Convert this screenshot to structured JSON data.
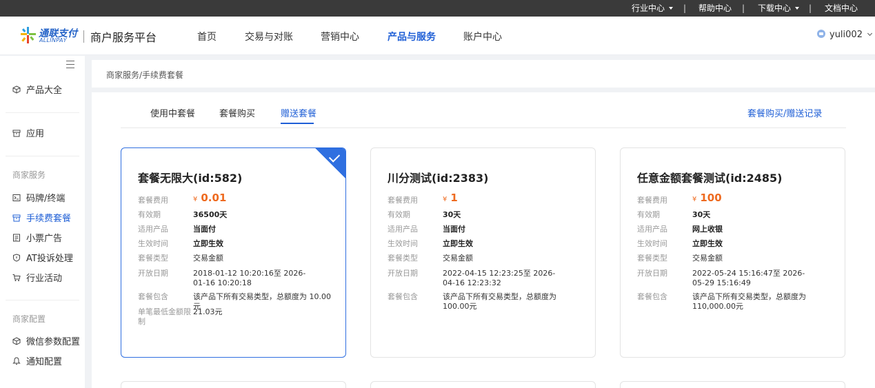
{
  "topbar": {
    "items": [
      "行业中心",
      "帮助中心",
      "下载中心",
      "文档中心"
    ],
    "separator": "|"
  },
  "header": {
    "logo_cn": "通联支付",
    "logo_en": "ALLINPAY",
    "platform_title": "商户服务平台",
    "nav": [
      "首页",
      "交易与对账",
      "营销中心",
      "产品与服务",
      "账户中心"
    ],
    "active_nav": "产品与服务",
    "username": "yuli002"
  },
  "sidebar": {
    "items_top": [
      "产品大全",
      "应用"
    ],
    "section_merchant_service": "商家服务",
    "merchant_items": [
      "码牌/终端",
      "手续费套餐",
      "小票广告",
      "AT投诉处理",
      "行业活动"
    ],
    "section_merchant_config": "商家配置",
    "config_items": [
      "微信参数配置",
      "通知配置"
    ],
    "active_item": "手续费套餐"
  },
  "breadcrumb": "商家服务/手续费套餐",
  "tabs": [
    "使用中套餐",
    "套餐购买",
    "赠送套餐"
  ],
  "active_tab": "赠送套餐",
  "record_link": "套餐购买/赠送记录",
  "currency_symbol": "¥",
  "cards": [
    {
      "title": "套餐无限大(id:582)",
      "selected": true,
      "fee_label": "套餐费用",
      "fee": "0.01",
      "validity_label": "有效期",
      "validity": "36500天",
      "product_label": "适用产品",
      "product": "当面付",
      "effect_label": "生效时间",
      "effect": "立即生效",
      "type_label": "套餐类型",
      "type": "交易金额",
      "open_label": "开放日期",
      "open": "2018-01-12 10:20:16至 2026-01-16 10:20:18",
      "include_label": "套餐包含",
      "include": "该产品下所有交易类型，总额度为 10.00元",
      "min_label": "单笔最低金额限制",
      "min": "21.03元"
    },
    {
      "title": "川分测试(id:2383)",
      "selected": false,
      "fee_label": "套餐费用",
      "fee": "1",
      "validity_label": "有效期",
      "validity": "30天",
      "product_label": "适用产品",
      "product": "当面付",
      "effect_label": "生效时间",
      "effect": "立即生效",
      "type_label": "套餐类型",
      "type": "交易金额",
      "open_label": "开放日期",
      "open": "2022-04-15 12:23:25至 2026-04-16 12:23:32",
      "include_label": "套餐包含",
      "include": "该产品下所有交易类型，总额度为 100.00元"
    },
    {
      "title": "任意金额套餐测试(id:2485)",
      "selected": false,
      "fee_label": "套餐费用",
      "fee": "100",
      "validity_label": "有效期",
      "validity": "30天",
      "product_label": "适用产品",
      "product": "网上收银",
      "effect_label": "生效时间",
      "effect": "立即生效",
      "type_label": "套餐类型",
      "type": "交易金额",
      "open_label": "开放日期",
      "open": "2022-05-24 15:16:47至 2026-05-29 15:16:49",
      "include_label": "套餐包含",
      "include": "该产品下所有交易类型，总额度为 110,000.00元"
    }
  ],
  "colors": {
    "accent": "#1f5fd6",
    "price": "#ee6a1f",
    "topbar": "#3a3a3a"
  }
}
